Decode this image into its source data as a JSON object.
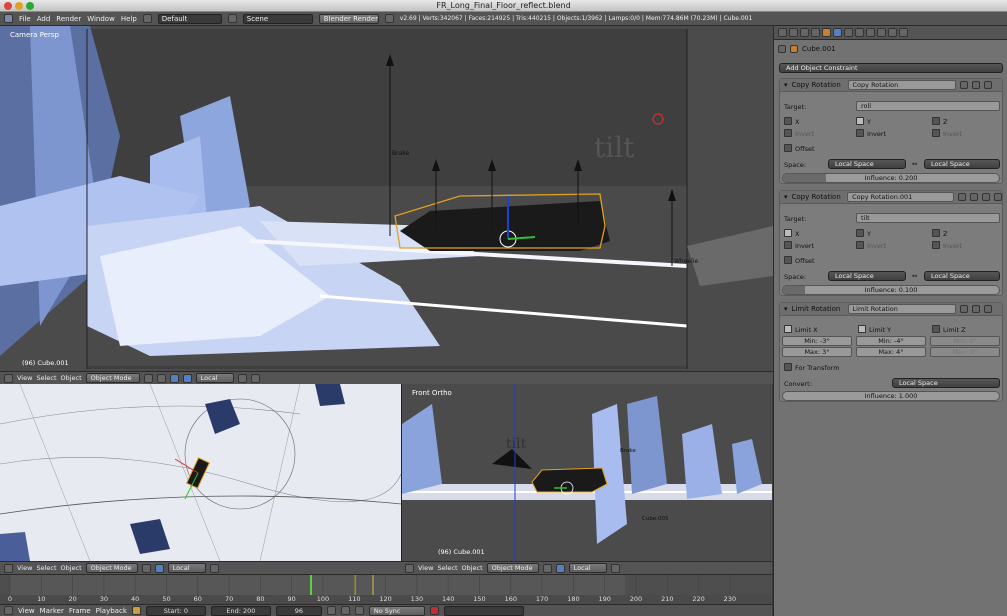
{
  "window": {
    "title": "FR_Long_Final_Floor_reflect.blend"
  },
  "menu": {
    "items": [
      "File",
      "Add",
      "Render",
      "Window",
      "Help"
    ],
    "layout": "Default",
    "scene": "Scene",
    "engine": "Blender Render",
    "stats": "v2.69 | Verts:342067 | Faces:214925 | Tris:440215 | Objects:1/3962 | Lamps:0/0 | Mem:774.86M (70.23M) | Cube.001"
  },
  "viewport_main": {
    "label": "Camera Persp",
    "object": "(96) Cube.001",
    "annotations": {
      "tilt": "tilt",
      "brake": "Brake",
      "wheelie": "Wheelie"
    }
  },
  "header_main": {
    "view": "View",
    "select": "Select",
    "object": "Object",
    "mode": "Object Mode",
    "pivot": "Local"
  },
  "viewport_front": {
    "label": "Front Ortho",
    "object": "(96) Cube.001",
    "tilt": "tilt",
    "brake": "Brake",
    "cube": "Cube.005"
  },
  "header_left": {
    "view": "View",
    "select": "Select",
    "object": "Object",
    "mode": "Object Mode",
    "pivot": "Local"
  },
  "header_right": {
    "view": "View",
    "select": "Select",
    "object": "Object",
    "mode": "Object Mode",
    "pivot": "Local"
  },
  "props": {
    "breadcrumb": "Cube.001",
    "add_constraint": "Add Object Constraint",
    "c1": {
      "type": "Copy Rotation",
      "name": "Copy Rotation",
      "target_label": "Target:",
      "target": "roll",
      "x": "X",
      "y": "Y",
      "z": "Z",
      "invert": "Invert",
      "offset": "Offset",
      "space_label": "Space:",
      "space1": "Local Space",
      "space2": "Local Space",
      "influence": "Influence: 0.200"
    },
    "c2": {
      "type": "Copy Rotation",
      "name": "Copy Rotation.001",
      "target_label": "Target:",
      "target": "tilt",
      "x": "X",
      "y": "Y",
      "z": "Z",
      "invert": "Invert",
      "offset": "Offset",
      "space_label": "Space:",
      "space1": "Local Space",
      "space2": "Local Space",
      "influence": "Influence: 0.100"
    },
    "c3": {
      "type": "Limit Rotation",
      "name": "Limit Rotation",
      "limit_x": "Limit X",
      "limit_y": "Limit Y",
      "limit_z": "Limit Z",
      "minx": "Min: -3°",
      "maxx": "Max: 3°",
      "miny": "Min: -4°",
      "maxy": "Max: 4°",
      "minz": "Min: 0°",
      "maxz": "Max: 0°",
      "for_transform": "For Transform",
      "convert_label": "Convert:",
      "convert": "Local Space",
      "influence": "Influence: 1.000"
    }
  },
  "timeline": {
    "ticks": [
      "0",
      "10",
      "20",
      "30",
      "40",
      "50",
      "60",
      "70",
      "80",
      "90",
      "100",
      "110",
      "120",
      "130",
      "140",
      "150",
      "160",
      "170",
      "180",
      "190",
      "200",
      "210",
      "220",
      "230"
    ]
  },
  "bottom": {
    "view": "View",
    "marker": "Marker",
    "frame": "Frame",
    "playback": "Playback",
    "start": "Start: 0",
    "end": "End: 200",
    "current": "96",
    "sync": "No Sync"
  },
  "colors": {
    "accent": "#5680c2",
    "panel": "#727272"
  }
}
